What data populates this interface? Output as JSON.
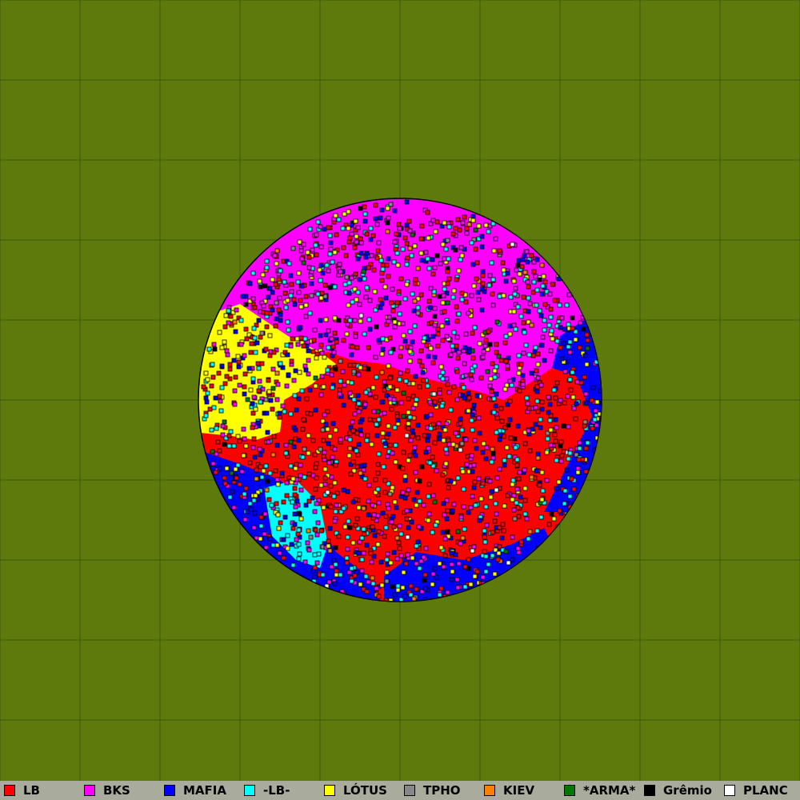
{
  "map": {
    "background_color": "#5f7a0c",
    "grid_color": "#3a5a10",
    "border_color": "#000000"
  },
  "tribes": [
    {
      "name": "LB",
      "color": "#ff0000"
    },
    {
      "name": "BKS",
      "color": "#ff00ff"
    },
    {
      "name": "MAFIA",
      "color": "#0000ff"
    },
    {
      "name": "-LB-",
      "color": "#00ffff"
    },
    {
      "name": "LÓTUS",
      "color": "#ffff00"
    },
    {
      "name": "TPHO",
      "color": "#888888"
    },
    {
      "name": "KIEV",
      "color": "#ff8000"
    },
    {
      "name": "*ARMA*",
      "color": "#007700"
    },
    {
      "name": "Grêmio",
      "color": "#000000"
    },
    {
      "name": "PLANC",
      "color": "#ffffff"
    }
  ]
}
